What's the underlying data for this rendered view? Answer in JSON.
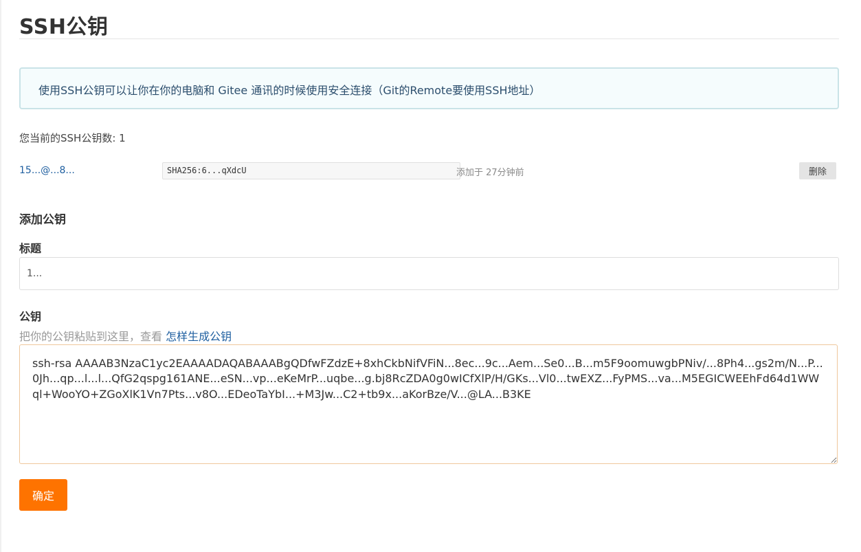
{
  "page": {
    "title": "SSH公钥",
    "info_message": "使用SSH公钥可以让你在你的电脑和 Gitee 通讯的时候使用安全连接（Git的Remote要使用SSH地址）"
  },
  "existing_keys": {
    "count_label": "您当前的SSH公钥数: 1",
    "items": [
      {
        "title": "15...@...8...",
        "fingerprint": "SHA256:6...qXdcU",
        "added": "添加于 27分钟前",
        "delete_label": "删除"
      }
    ]
  },
  "add_key": {
    "section_title": "添加公钥",
    "title_label": "标题",
    "title_value": "1...",
    "key_label": "公钥",
    "key_hint": "把你的公钥粘贴到这里，查看",
    "key_hint_link": "怎样生成公钥",
    "key_value": "ssh-rsa AAAAB3NzaC1yc2EAAAADAQABAAABgQDfwFZdzE+8xhCkbNifVFiN...8ec...9c...Aem...Se0...B...m5F9oomuwgbPNiv/...8Ph4...gs2m/N...P...0Jh...qp...l...l...QfG2qspg161ANE...eSN...vp...eKeMrP...uqbe...g.bj8RcZDA0g0wICfXlP/H/GKs...Vl0...twEXZ...FyPMS...va...M5EGICWEEhFd64d1WWql+WooYO+ZGoXlK1Vn7Pts...v8O...EDeoTaYbI...+M3Jw...C2+tb9x...aKorBze/V...@LA...B3KE",
    "submit_label": "确定"
  },
  "colors": {
    "accent": "#fe7300",
    "link": "#1f5fa0",
    "info_bg": "#f5fcfd",
    "info_border": "#c9e3e7"
  }
}
